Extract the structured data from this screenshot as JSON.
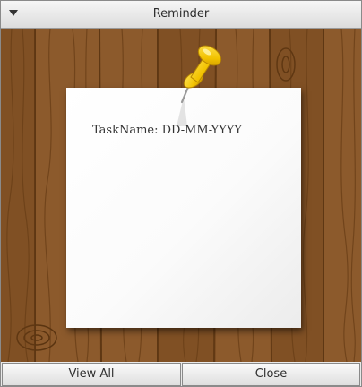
{
  "window": {
    "title": "Reminder"
  },
  "note": {
    "text": "TaskName: DD-MM-YYYY"
  },
  "buttons": {
    "view_all": "View All",
    "close": "Close"
  },
  "icons": {
    "menu": "dropdown-arrow-icon",
    "pin": "pushpin-icon"
  },
  "colors": {
    "wood": "#8b5a2b",
    "wood_dark": "#6b3f1a",
    "pin": "#f2c200",
    "note": "#ffffff"
  }
}
